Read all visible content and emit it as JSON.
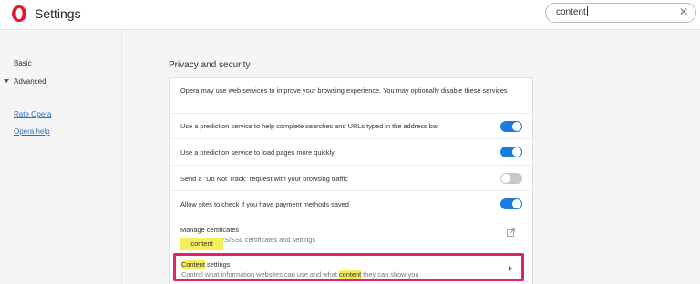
{
  "header": {
    "title": "Settings",
    "search_value": "content",
    "search_clear": "✕",
    "logo_color": "#e0172d"
  },
  "sidebar": {
    "basic": "Basic",
    "advanced": "Advanced",
    "rate": "Rate Opera",
    "help": "Opera help"
  },
  "section": {
    "title": "Privacy and security",
    "intro": "Opera may use web services to improve your browsing experience. You may optionally disable these services",
    "toggles": [
      {
        "label": "Use a prediction service to help complete searches and URLs typed in the address bar",
        "on": true
      },
      {
        "label": "Use a prediction service to load pages more quickly",
        "on": true
      },
      {
        "label": "Send a \"Do Not Track\" request with your browsing traffic",
        "on": false
      },
      {
        "label": "Allow sites to check if you have payment methods saved",
        "on": true
      }
    ],
    "certificates": {
      "title": "Manage certificates",
      "subtitle": "Manage HTTPS/SSL certificates and settings"
    },
    "tooltip": "content",
    "content_settings": {
      "title_hl": "Content",
      "title_rest": " settings",
      "sub_pre": "Control what information websites can use and what ",
      "sub_hl": "content",
      "sub_post": " they can show you"
    }
  },
  "colors": {
    "accent": "#1b7ce0",
    "highlight": "#f6ee5c",
    "focus_border": "#e0226b"
  }
}
